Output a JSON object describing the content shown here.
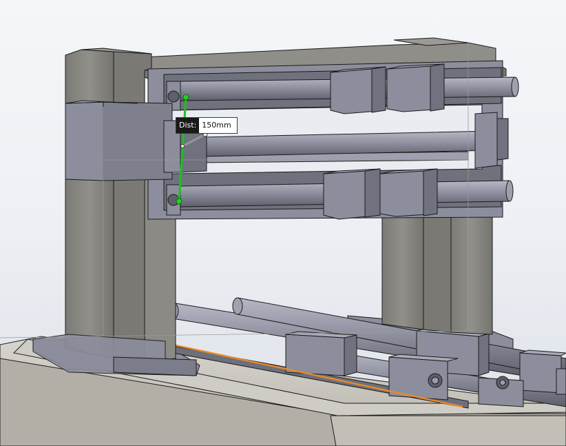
{
  "dimension": {
    "label": "Dist:",
    "value": "150mm",
    "highlight_color": "#1ec21e",
    "selected_edge_color": "#e58a2a"
  },
  "colors": {
    "part_fill": "#8c8e9d",
    "part_dark": "#70727f",
    "part_light": "#a8aab8",
    "frame_fill": "#8b8a84",
    "base_fill": "#c9c6bf",
    "edge": "#1a1a1a"
  }
}
